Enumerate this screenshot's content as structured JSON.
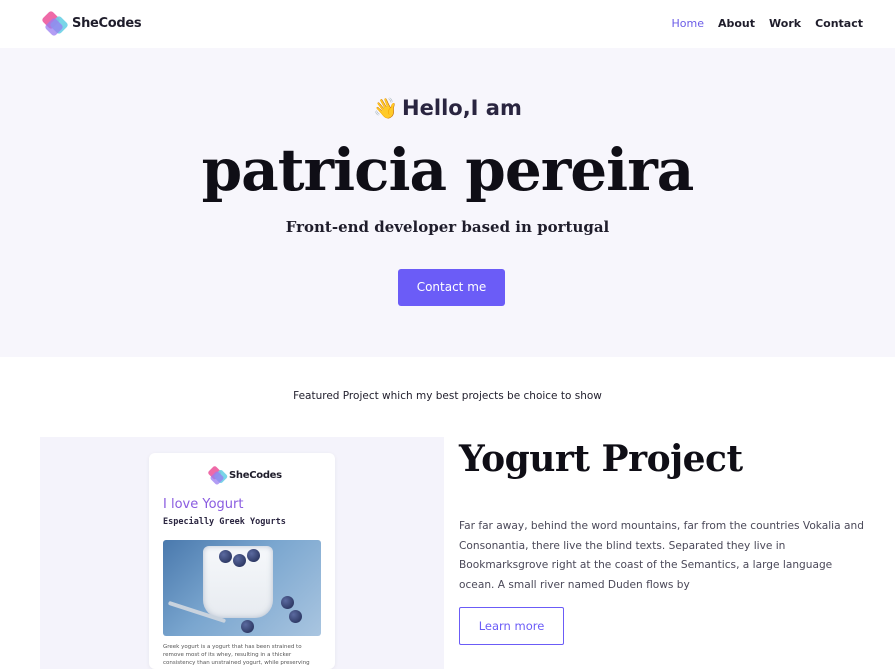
{
  "brand": {
    "name": "SheCodes",
    "logo_icon": "shecodes-logo-icon"
  },
  "nav": {
    "items": [
      {
        "label": "Home",
        "active": true
      },
      {
        "label": "About",
        "active": false
      },
      {
        "label": "Work",
        "active": false
      },
      {
        "label": "Contact",
        "active": false
      }
    ]
  },
  "hero": {
    "wave_emoji": "👋",
    "greeting": "Hello,I am",
    "name": "patricia pereira",
    "tagline": "Front-end developer based in portugal",
    "cta_label": "Contact me"
  },
  "featured": {
    "heading": "Featured Project which my best projects be choice to show"
  },
  "project_card": {
    "brand": "SheCodes",
    "title": "I love Yogurt",
    "subtitle": "Especially Greek Yogurts",
    "body": "Greek yogurt is a yogurt that has been strained to remove most of its whey, resulting in a thicker consistency than unstrained yogurt, while preserving"
  },
  "project": {
    "title": "Yogurt Project",
    "description": "Far far away, behind the word mountains, far from the countries Vokalia and Consonantia, there live the blind texts. Separated they live in Bookmarksgrove right at the coast of the Semantics, a large language ocean. A small river named Duden flows by",
    "button_label": "Learn more"
  },
  "colors": {
    "accent": "#6b5cf7",
    "hero_bg": "#f7f6fc",
    "card_title": "#8a5ce0"
  }
}
